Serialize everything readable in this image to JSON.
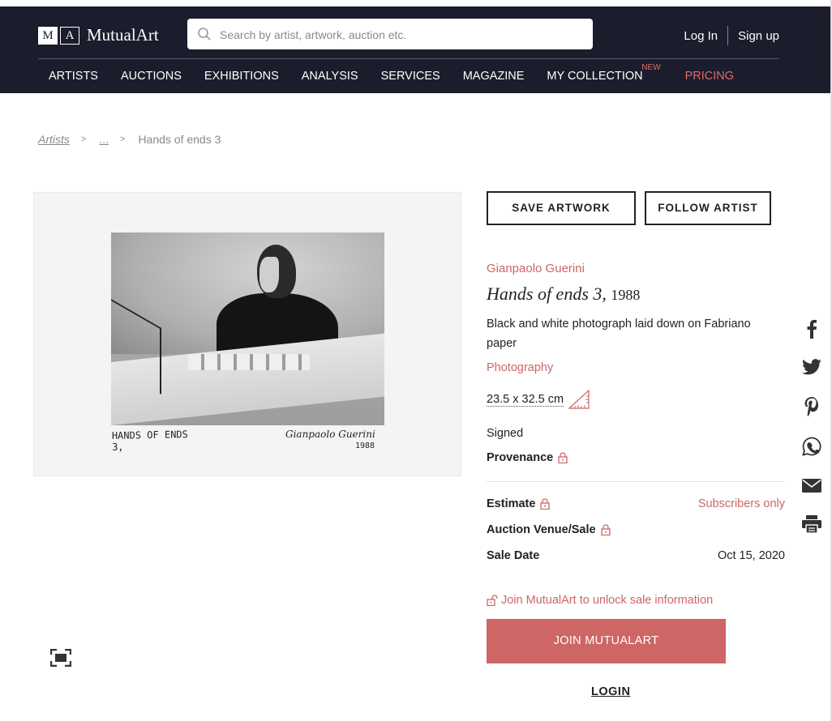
{
  "header": {
    "logo_letters": [
      "M",
      "A"
    ],
    "logo_name": "MutualArt",
    "search_placeholder": "Search by artist, artwork, auction etc.",
    "login": "Log In",
    "signup": "Sign up",
    "nav": [
      "ARTISTS",
      "AUCTIONS",
      "EXHIBITIONS",
      "ANALYSIS",
      "SERVICES",
      "MAGAZINE",
      "MY COLLECTION"
    ],
    "nav_new_badge": "NEW",
    "nav_pricing": "PRICING"
  },
  "breadcrumb": {
    "artists": "Artists",
    "gt": ">",
    "ellipsis": "...",
    "current": "Hands of ends 3"
  },
  "artwork_image": {
    "inscription_line1": "HANDS OF ENDS",
    "inscription_line2": "3,",
    "signature": "Gianpaolo Guerini",
    "signature_year": "1988"
  },
  "actions": {
    "save": "SAVE ARTWORK",
    "follow": "FOLLOW ARTIST"
  },
  "details": {
    "artist": "Gianpaolo Guerini",
    "title": "Hands of ends 3,",
    "year": "1988",
    "medium": "Black and white photograph laid down on Fabriano paper",
    "category": "Photography",
    "size": "23.5 x 32.5 cm",
    "signed": "Signed",
    "provenance_label": "Provenance",
    "estimate_label": "Estimate",
    "estimate_value": "Subscribers only",
    "venue_label": "Auction Venue/Sale",
    "sale_date_label": "Sale Date",
    "sale_date_value": "Oct 15, 2020",
    "unlock_text": "Join MutualArt to unlock sale information",
    "join_button": "JOIN MUTUALART",
    "login_link": "LOGIN"
  },
  "social_icons": [
    "facebook-icon",
    "twitter-icon",
    "pinterest-icon",
    "whatsapp-icon",
    "email-icon",
    "print-icon"
  ],
  "colors": {
    "header_bg": "#1b1d2c",
    "accent": "#cf6666",
    "accent_text": "#cc6666"
  }
}
